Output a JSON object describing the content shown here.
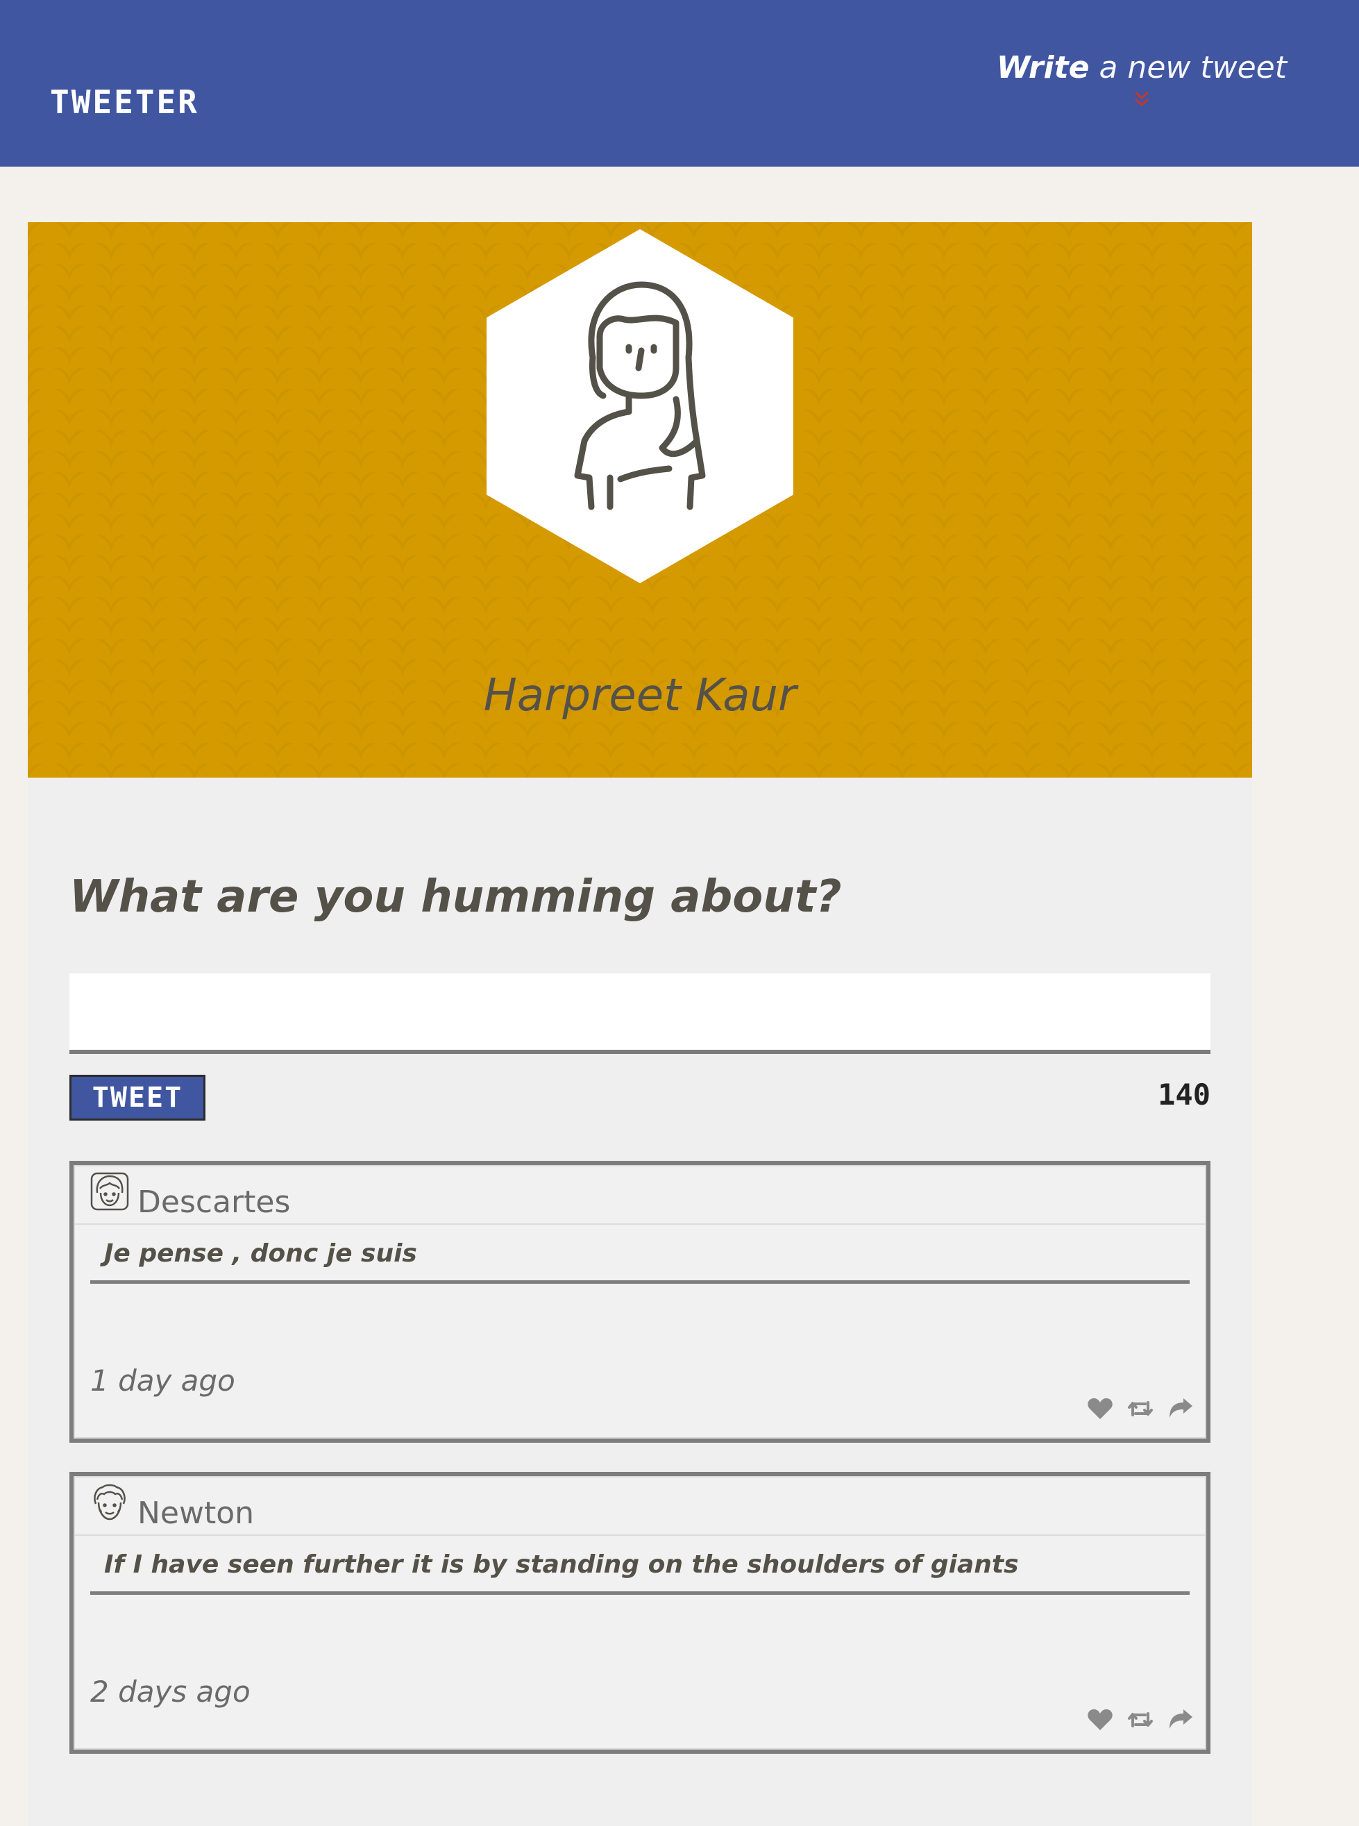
{
  "nav": {
    "logo": "TWEETER",
    "compose_bold": "Write",
    "compose_rest": " a new tweet",
    "compose_icon": "chevron-double-down-icon",
    "compose_icon_color": "#c0392b"
  },
  "colors": {
    "nav_bg": "#4056a1",
    "page_bg": "#f4f1ec",
    "profile_bg": "#d59a00",
    "text": "#545149"
  },
  "profile": {
    "name": "Harpreet Kaur",
    "avatar_icon": "woman-avatar-icon"
  },
  "compose": {
    "heading": "What are you humming about?",
    "input_value": "",
    "button_label": "TWEET",
    "char_count": "140"
  },
  "tweets": [
    {
      "author": "Descartes",
      "avatar_icon": "descartes-avatar-icon",
      "text": "Je pense , donc je suis",
      "time": "1 day ago",
      "actions": [
        "heart-icon",
        "retweet-icon",
        "share-icon"
      ]
    },
    {
      "author": "Newton",
      "avatar_icon": "newton-avatar-icon",
      "text": "If I have seen further it is by standing on the shoulders of giants",
      "time": "2 days ago",
      "actions": [
        "heart-icon",
        "retweet-icon",
        "share-icon"
      ]
    }
  ]
}
